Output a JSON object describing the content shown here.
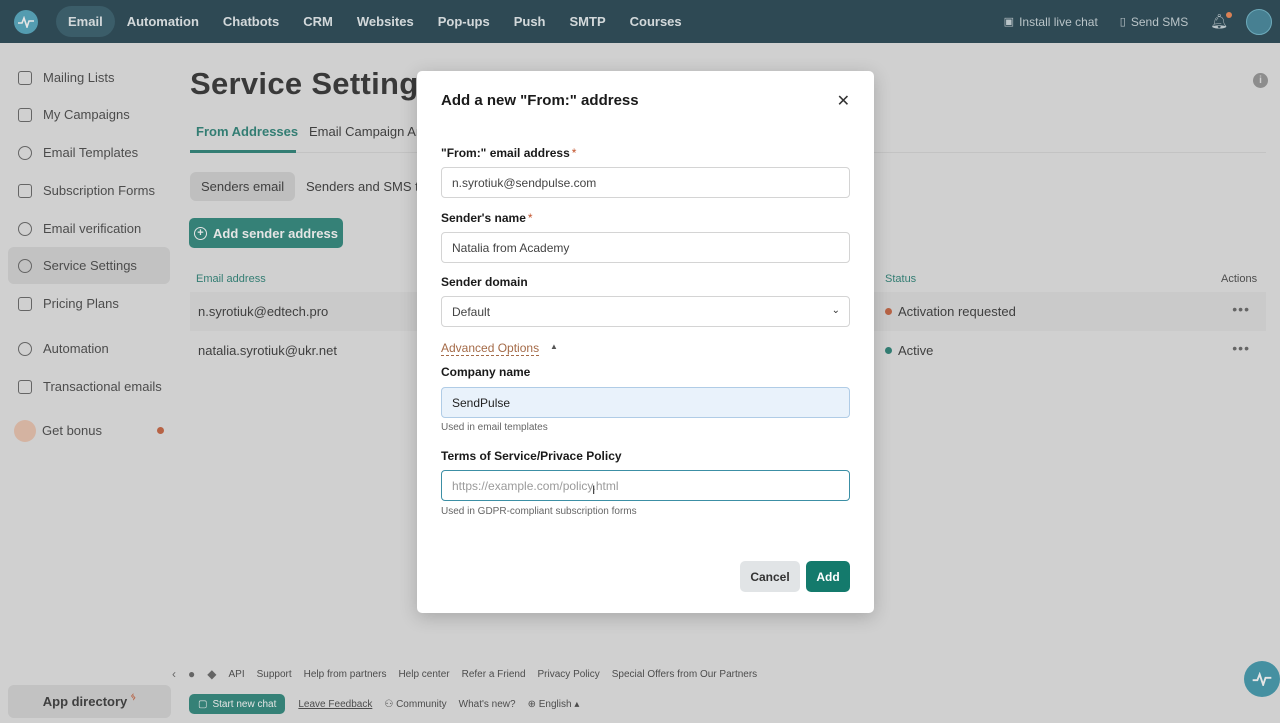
{
  "topnav": {
    "items": [
      {
        "label": "Email"
      },
      {
        "label": "Automation"
      },
      {
        "label": "Chatbots"
      },
      {
        "label": "CRM"
      },
      {
        "label": "Websites"
      },
      {
        "label": "Pop-ups"
      },
      {
        "label": "Push"
      },
      {
        "label": "SMTP"
      },
      {
        "label": "Courses"
      }
    ],
    "active": "Email",
    "install_live_chat": "Install live chat",
    "send_sms": "Send SMS"
  },
  "sidebar": {
    "items": [
      {
        "label": "Mailing Lists",
        "icon": "list-icon"
      },
      {
        "label": "My Campaigns",
        "icon": "campaign-icon"
      },
      {
        "label": "Email Templates",
        "icon": "template-icon"
      },
      {
        "label": "Subscription Forms",
        "icon": "form-icon"
      },
      {
        "label": "Email verification",
        "icon": "check-icon"
      },
      {
        "label": "Service Settings",
        "icon": "settings-icon"
      },
      {
        "label": "Pricing Plans",
        "icon": "pricing-icon"
      },
      {
        "label": "Automation",
        "icon": "automation-icon"
      },
      {
        "label": "Transactional emails",
        "icon": "grid-icon"
      },
      {
        "label": "Get bonus",
        "icon": "bonus-icon"
      }
    ],
    "app_directory": "App directory"
  },
  "main": {
    "title": "Service Settings",
    "tabs": [
      {
        "label": "From Addresses"
      },
      {
        "label": "Email Campaign Ar"
      }
    ],
    "subtabs": [
      {
        "label": "Senders email"
      },
      {
        "label": "Senders and SMS t"
      }
    ],
    "add_button": "Add sender address",
    "table": {
      "headers": {
        "email": "Email address",
        "status": "Status",
        "actions": "Actions"
      },
      "rows": [
        {
          "email": "n.syrotiuk@edtech.pro",
          "status": "Activation requested",
          "status_color": "#c2522a"
        },
        {
          "email": "natalia.syrotiuk@ukr.net",
          "status": "Active",
          "status_color": "#127567"
        }
      ]
    }
  },
  "footer": {
    "links": [
      "API",
      "Support",
      "Help from partners",
      "Help center",
      "Refer a Friend",
      "Privacy Policy",
      "Special Offers from Our Partners"
    ],
    "chat_button": "Start new chat",
    "feedback": "Leave Feedback",
    "community": "Community",
    "whats_new": "What's new?",
    "language": "English"
  },
  "modal": {
    "title": "Add a new \"From:\" address",
    "from_label": "\"From:\" email address",
    "from_value": "n.syrotiuk@sendpulse.com",
    "name_label": "Sender's name",
    "name_value": "Natalia from Academy",
    "domain_label": "Sender domain",
    "domain_value": "Default",
    "advanced": "Advanced Options",
    "company_label": "Company name",
    "company_value": "SendPulse",
    "company_hint": "Used in email templates",
    "terms_label": "Terms of Service/Privace Policy",
    "terms_placeholder": "https://example.com/policy.html",
    "terms_hint": "Used in GDPR-compliant subscription forms",
    "cancel": "Cancel",
    "add": "Add"
  },
  "colors": {
    "nav_bg": "#0b2f3e",
    "accent": "#147a6c",
    "required": "#c2522a"
  }
}
